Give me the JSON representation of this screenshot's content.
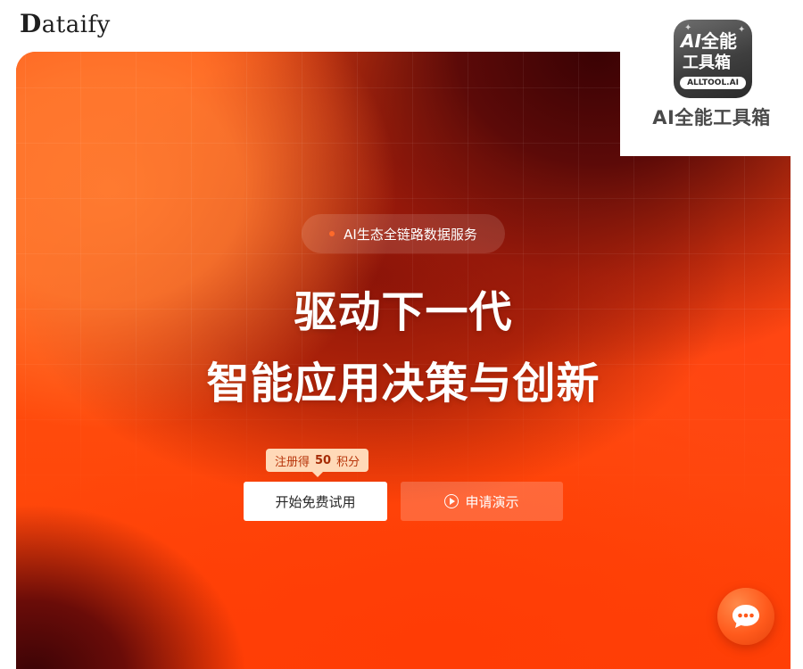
{
  "brand": {
    "logo_cap": "D",
    "logo_rest": "ataify"
  },
  "hero": {
    "badge_text": "AI生态全链路数据服务",
    "headline_line1": "驱动下一代",
    "headline_line2": "智能应用决策与创新",
    "bonus": {
      "prefix": "注册得",
      "number": "50",
      "suffix": "积分"
    },
    "primary_button": "开始免费试用",
    "demo_button": "申请演示"
  },
  "watermark": {
    "icon_line1_a": "AI",
    "icon_line1_b": "全能",
    "icon_line2": "工具箱",
    "icon_badge": "ALLTOOL.AI",
    "caption": "AI全能工具箱"
  },
  "icons": {
    "play": "play-circle-icon",
    "chat": "chat-bubble-icon"
  },
  "colors": {
    "hero_orange": "#ff4a0c",
    "hero_dark": "#3a0204",
    "bonus_bg": "#ffd9b8",
    "primary_button_bg": "#ffffff"
  }
}
